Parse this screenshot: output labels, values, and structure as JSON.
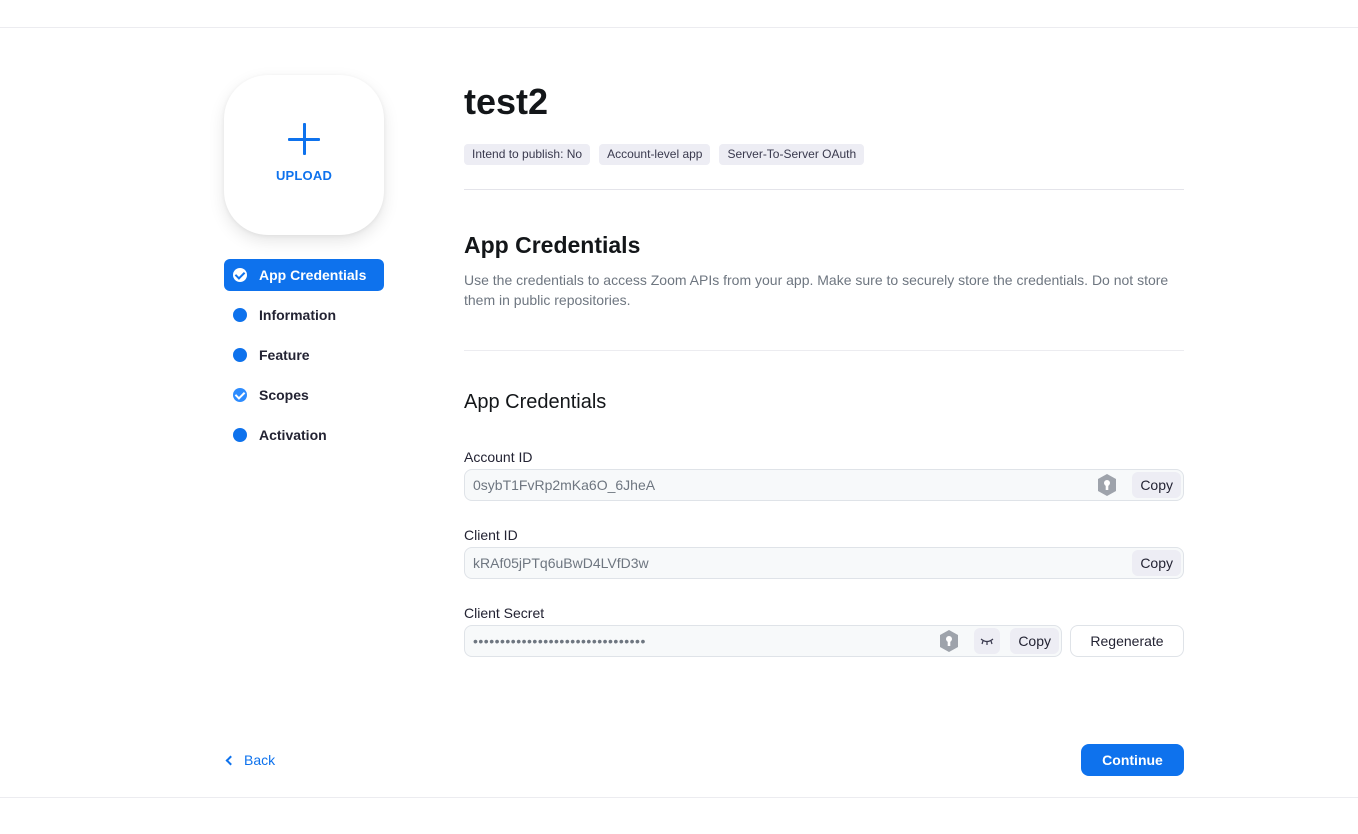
{
  "upload": {
    "label": "UPLOAD"
  },
  "steps": [
    {
      "label": "App Credentials",
      "icon": "check-circle-icon",
      "active": true
    },
    {
      "label": "Information",
      "icon": "dot-icon"
    },
    {
      "label": "Feature",
      "icon": "dot-icon"
    },
    {
      "label": "Scopes",
      "icon": "check-circle-icon"
    },
    {
      "label": "Activation",
      "icon": "dot-icon"
    }
  ],
  "app": {
    "name": "test2",
    "tags": [
      "Intend to publish: No",
      "Account-level app",
      "Server-To-Server OAuth"
    ]
  },
  "section": {
    "title": "App Credentials",
    "description": "Use the credentials to access Zoom APIs from your app. Make sure to securely store the credentials. Do not store them in public repositories."
  },
  "credentials": {
    "title": "App Credentials",
    "account_id": {
      "label": "Account ID",
      "value": "0sybT1FvRp2mKa6O_6JheA",
      "copy_label": "Copy"
    },
    "client_id": {
      "label": "Client ID",
      "value": "kRAf05jPTq6uBwD4LVfD3w",
      "copy_label": "Copy"
    },
    "client_secret": {
      "label": "Client Secret",
      "value": "••••••••••••••••••••••••••••••••",
      "copy_label": "Copy",
      "regenerate_label": "Regenerate"
    }
  },
  "footer": {
    "back_label": "Back",
    "continue_label": "Continue"
  },
  "colors": {
    "accent": "#0e72ed"
  }
}
